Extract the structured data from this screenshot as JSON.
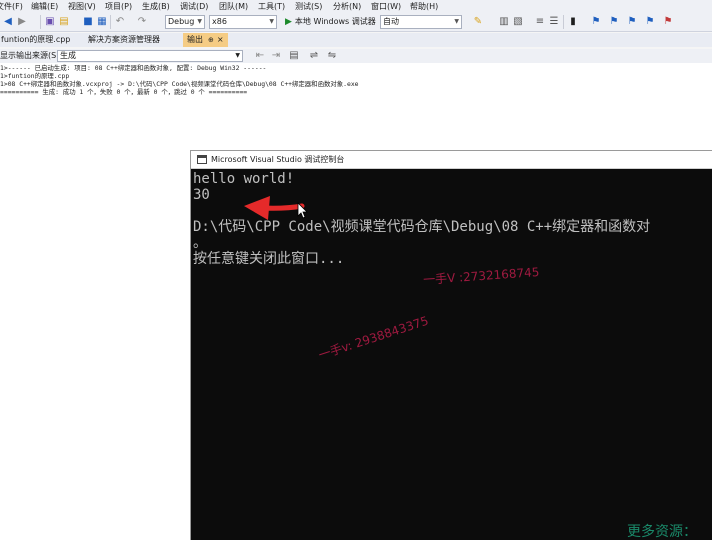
{
  "menu": [
    "文件(F)",
    "编辑(E)",
    "视图(V)",
    "项目(P)",
    "生成(B)",
    "调试(D)",
    "团队(M)",
    "工具(T)",
    "测试(S)",
    "分析(N)",
    "窗口(W)",
    "帮助(H)"
  ],
  "toolbar": {
    "config": "Debug",
    "platform": "x86",
    "run_label": "本地 Windows 调试器",
    "run_mode": "自动"
  },
  "tabs": [
    {
      "label": "funtion的原理.cpp"
    },
    {
      "label": "解决方案资源管理器"
    },
    {
      "label": "输出",
      "pin": "⊕",
      "close": "×"
    }
  ],
  "output_pane": {
    "source_label": "显示输出来源(S):",
    "source_value": "生成",
    "lines": [
      "1>------ 已启动生成: 项目: 08 C++绑定器和函数对象, 配置: Debug Win32 ------",
      "1>funtion的原理.cpp",
      "1>08 C++绑定器和函数对象.vcxproj -> D:\\代码\\CPP Code\\视频课堂代码仓库\\Debug\\08 C++绑定器和函数对象.exe",
      "========== 生成: 成功 1 个，失败 0 个，最新 0 个，跳过 0 个 =========="
    ]
  },
  "console": {
    "title": "Microsoft Visual Studio 调试控制台",
    "lines": [
      "hello world!",
      "30",
      "",
      "D:\\代码\\CPP Code\\视频课堂代码仓库\\Debug\\08 C++绑定器和函数对",
      "。",
      "按任意键关闭此窗口..."
    ],
    "watermark1": "一手V :2732168745",
    "watermark2": "一手v: 2938843375",
    "more_resources": "更多资源："
  },
  "colors": {
    "accent_tab": "#f5cc84",
    "console_bg": "#0c0c0c",
    "annotation_arrow": "#e52a2a",
    "watermark": "#9f1a40"
  }
}
